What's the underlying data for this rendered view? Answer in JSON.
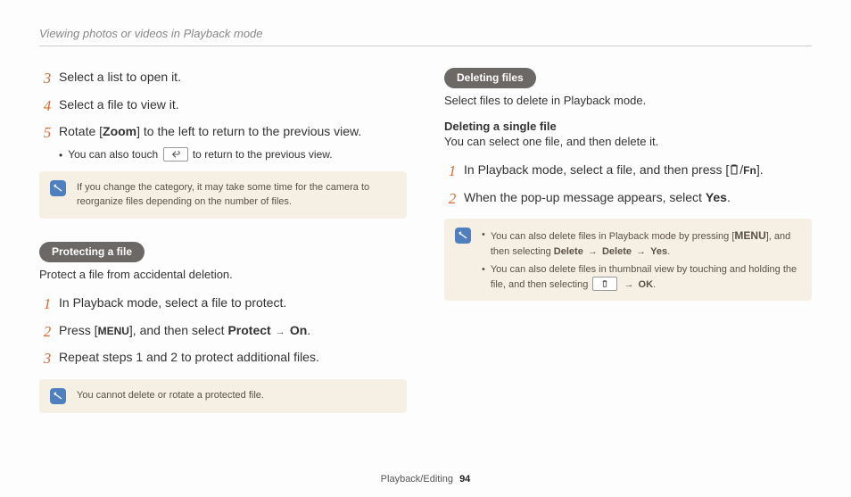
{
  "header": "Viewing photos or videos in Playback mode",
  "left": {
    "step3": "Select a list to open it.",
    "step4": "Select a file to view it.",
    "step5_pre": "Rotate [",
    "step5_zoom": "Zoom",
    "step5_post": "] to the left to return to the previous view.",
    "step5_sub_pre": "You can also touch ",
    "step5_sub_post": " to return to the previous view.",
    "note1": "If you change the category, it may take some time for the camera to reorganize files depending on the number of files.",
    "pill": "Protecting a file",
    "intro": "Protect a file from accidental deletion.",
    "p1": "In Playback mode, select a file to protect.",
    "p2_pre": "Press [",
    "p2_menu": "MENU",
    "p2_mid": "], and then select ",
    "p2_protect": "Protect",
    "p2_on": "On",
    "p2_end": ".",
    "p3": "Repeat steps 1 and 2 to protect additional files.",
    "note2": "You cannot delete or rotate a protected file."
  },
  "right": {
    "pill": "Deleting files",
    "intro": "Select files to delete in Playback mode.",
    "subhead": "Deleting a single file",
    "subintro": "You can select one file, and then delete it.",
    "d1_pre": "In Playback mode, select a file, and then press [",
    "d1_fn": "Fn",
    "d1_post": "].",
    "d2_pre": "When the pop-up message appears, select ",
    "d2_yes": "Yes",
    "d2_end": ".",
    "nA_pre": "You can also delete files in Playback mode by pressing [",
    "nA_menu": "MENU",
    "nA_mid": "], and then selecting ",
    "nA_del1": "Delete",
    "nA_del2": "Delete",
    "nA_yes": "Yes",
    "nA_end": ".",
    "nB_pre": "You can also delete files in thumbnail view by touching and holding the file, and then selecting ",
    "nB_ok": "OK",
    "nB_end": "."
  },
  "footer": {
    "section": "Playback/Editing",
    "page": "94"
  }
}
